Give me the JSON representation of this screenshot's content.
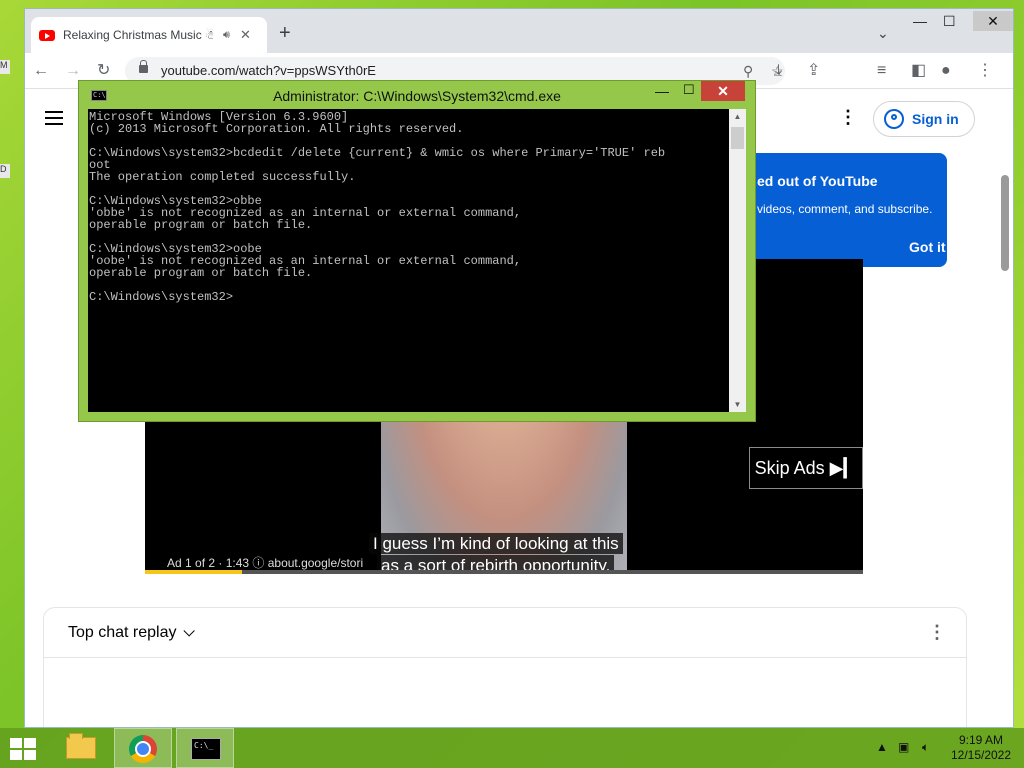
{
  "browser": {
    "tab_title": "Relaxing Christmas Music ☃",
    "tab_audio_icon": "speaker-icon",
    "url": "youtube.com/watch?v=ppsWSYth0rE",
    "new_tab_glyph": "+",
    "close_glyph": "✕",
    "min_glyph": "—",
    "max_glyph": "☐"
  },
  "youtube": {
    "sign_in": "Sign in",
    "popup": {
      "title": "ed out of YouTube",
      "text": "videos, comment, and subscribe.",
      "button": "Got it"
    },
    "video": {
      "skip_ads": "Skip Ads ▶▎",
      "caption_line1": "I guess I’m kind of looking at this",
      "caption_line2": "as a sort of rebirth opportunity.",
      "ad_info": "Ad 1 of 2 · 1:43  ⓘ   about.google/stori",
      "progress": 0.135
    },
    "chat_title": "Top chat replay"
  },
  "cmd": {
    "title": "Administrator: C:\\Windows\\System32\\cmd.exe",
    "lines": "Microsoft Windows [Version 6.3.9600]\n(c) 2013 Microsoft Corporation. All rights reserved.\n\nC:\\Windows\\system32>bcdedit /delete {current} & wmic os where Primary='TRUE' reb\noot\nThe operation completed successfully.\n\nC:\\Windows\\system32>obbe\n'obbe' is not recognized as an internal or external command,\noperable program or batch file.\n\nC:\\Windows\\system32>oobe\n'oobe' is not recognized as an internal or external command,\noperable program or batch file.\n\nC:\\Windows\\system32>",
    "close_glyph": "✕",
    "min_glyph": "—",
    "max_glyph": "☐"
  },
  "taskbar": {
    "time": "9:19 AM",
    "date": "12/15/2022",
    "apps": [
      "file-explorer",
      "chrome",
      "cmd"
    ]
  }
}
